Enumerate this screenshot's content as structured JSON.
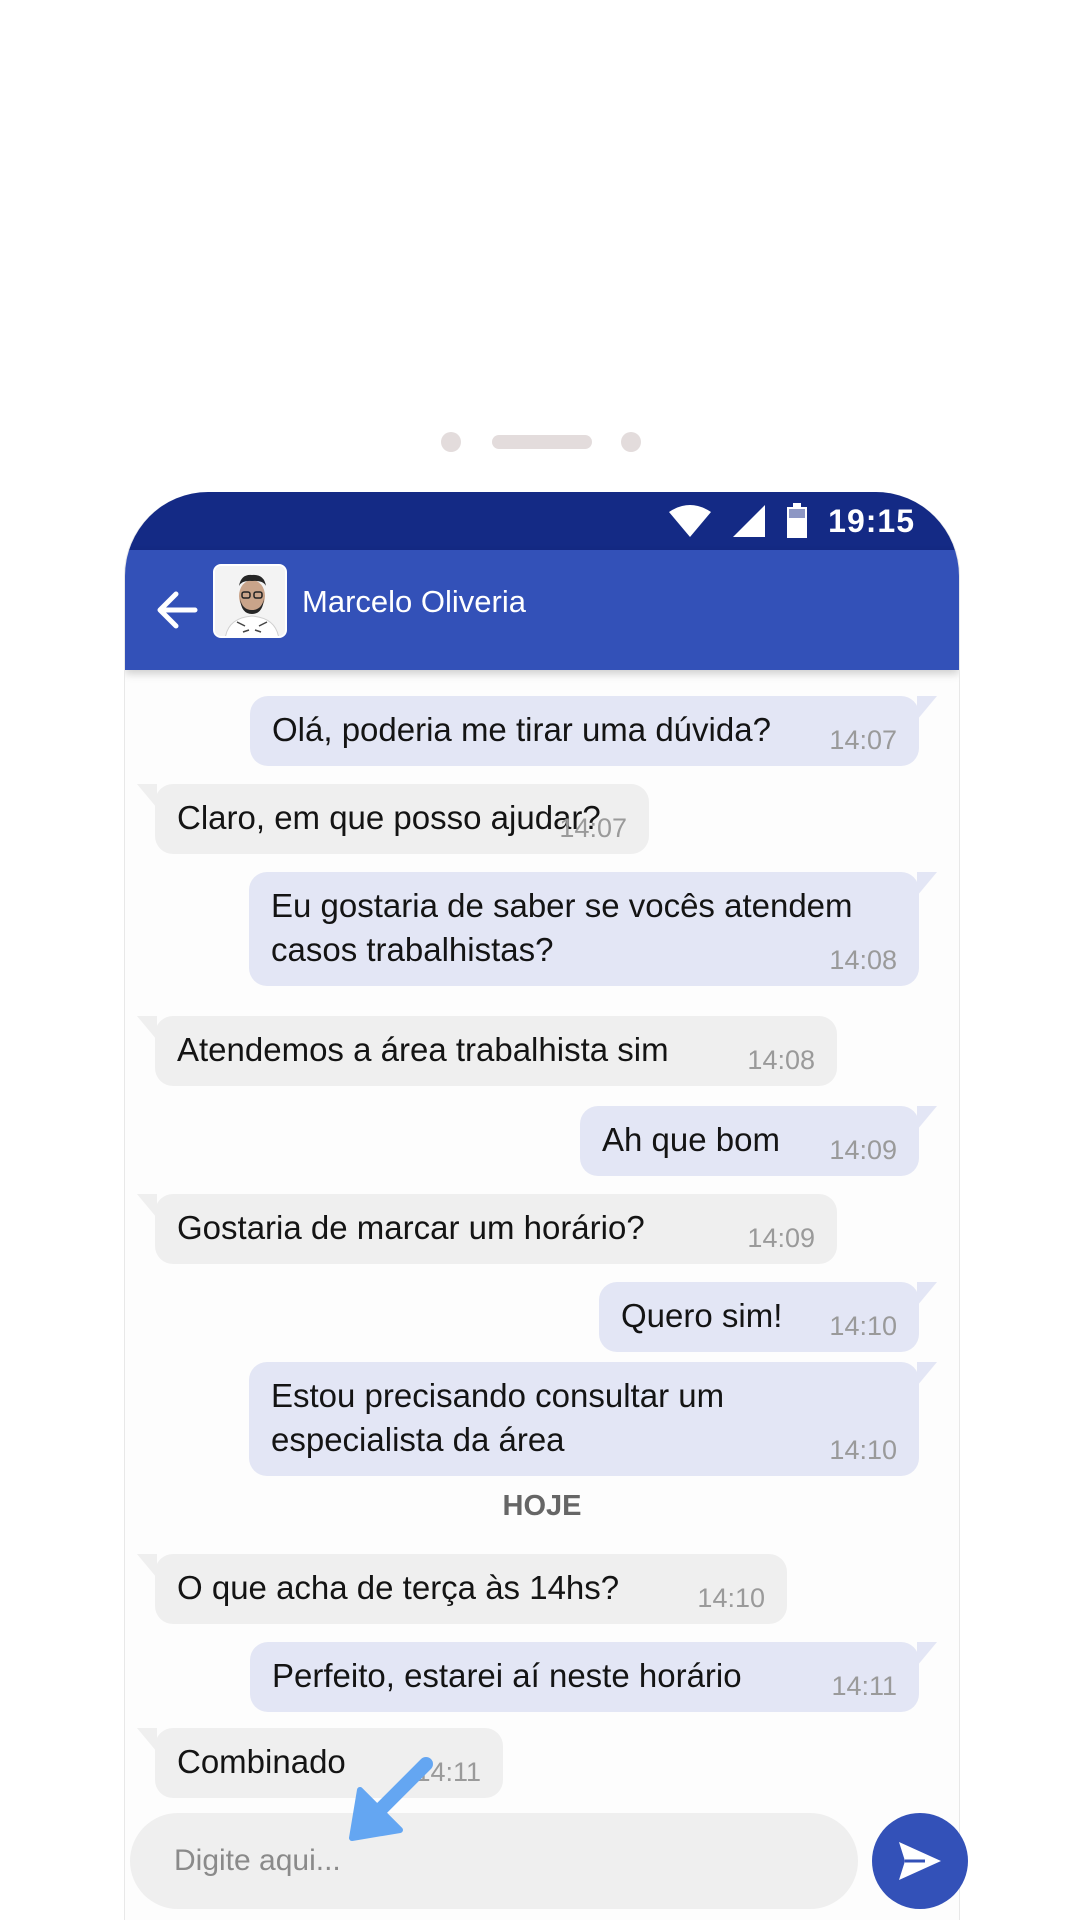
{
  "status_bar": {
    "time": "19:15"
  },
  "header": {
    "contact_name": "Marcelo Oliveria"
  },
  "messages": [
    {
      "direction": "out",
      "text": "Olá, poderia me tirar uma dúvida?",
      "time": "14:07"
    },
    {
      "direction": "in",
      "text": "Claro, em que posso ajudar?",
      "time": "14:07"
    },
    {
      "direction": "out",
      "text": "Eu gostaria de saber se vocês atendem\ncasos trabalhistas?",
      "time": "14:08"
    },
    {
      "direction": "in",
      "text": "Atendemos a área trabalhista sim",
      "time": "14:08"
    },
    {
      "direction": "out",
      "text": "Ah que bom",
      "time": "14:09"
    },
    {
      "direction": "in",
      "text": "Gostaria de marcar um horário?",
      "time": "14:09"
    },
    {
      "direction": "out",
      "text": "Quero sim!",
      "time": "14:10"
    },
    {
      "direction": "out",
      "text": "Estou precisando consultar um\nespecialista da área",
      "time": "14:10"
    },
    {
      "direction": "in",
      "text": "O que acha de terça às 14hs?",
      "time": "14:10"
    },
    {
      "direction": "out",
      "text": "Perfeito, estarei aí neste horário",
      "time": "14:11"
    },
    {
      "direction": "in",
      "text": "Combinado",
      "time": "14:11"
    }
  ],
  "day_divider": "HOJE",
  "composer": {
    "placeholder": "Digite aqui..."
  },
  "colors": {
    "status_bar": "#142a85",
    "app_bar": "#3351b8",
    "outgoing_bubble": "#e3e6f5",
    "incoming_bubble": "#efefef",
    "hint_arrow": "#64a6f2"
  },
  "icons": {
    "back": "arrow-left-icon",
    "wifi": "wifi-icon",
    "signal": "signal-icon",
    "battery": "battery-icon",
    "send": "send-icon",
    "hint": "arrow-down-left-icon"
  }
}
